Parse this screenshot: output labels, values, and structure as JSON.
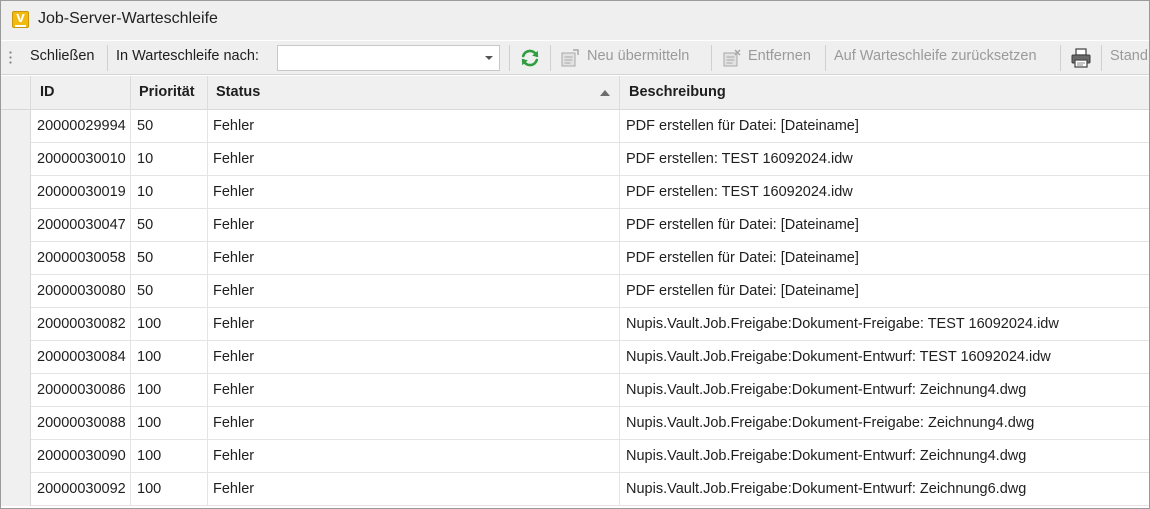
{
  "window": {
    "title": "Job-Server-Warteschleife",
    "app_icon_letter": "V"
  },
  "toolbar": {
    "close_label": "Schließen",
    "hold_label": "In Warteschleife nach:",
    "hold_value": "",
    "refresh_icon": "refresh-icon",
    "resubmit_label": "Neu übermitteln",
    "remove_label": "Entfernen",
    "reset_label": "Auf Warteschleife zurücksetzen",
    "print_icon": "print-icon",
    "standard_label": "Stand"
  },
  "grid": {
    "columns": {
      "id": "ID",
      "priority": "Priorität",
      "status": "Status",
      "description": "Beschreibung"
    },
    "sort_column": "Status",
    "sort_direction": "ascending",
    "rows": [
      {
        "id": "20000029994",
        "priority": "50",
        "status": "Fehler",
        "description": "PDF erstellen für Datei: [Dateiname]"
      },
      {
        "id": "20000030010",
        "priority": "10",
        "status": "Fehler",
        "description": "PDF erstellen: TEST 16092024.idw"
      },
      {
        "id": "20000030019",
        "priority": "10",
        "status": "Fehler",
        "description": "PDF erstellen: TEST 16092024.idw"
      },
      {
        "id": "20000030047",
        "priority": "50",
        "status": "Fehler",
        "description": "PDF erstellen für Datei: [Dateiname]"
      },
      {
        "id": "20000030058",
        "priority": "50",
        "status": "Fehler",
        "description": "PDF erstellen für Datei: [Dateiname]"
      },
      {
        "id": "20000030080",
        "priority": "50",
        "status": "Fehler",
        "description": "PDF erstellen für Datei: [Dateiname]"
      },
      {
        "id": "20000030082",
        "priority": "100",
        "status": "Fehler",
        "description": "Nupis.Vault.Job.Freigabe:Dokument-Freigabe: TEST 16092024.idw"
      },
      {
        "id": "20000030084",
        "priority": "100",
        "status": "Fehler",
        "description": "Nupis.Vault.Job.Freigabe:Dokument-Entwurf: TEST 16092024.idw"
      },
      {
        "id": "20000030086",
        "priority": "100",
        "status": "Fehler",
        "description": "Nupis.Vault.Job.Freigabe:Dokument-Entwurf: Zeichnung4.dwg"
      },
      {
        "id": "20000030088",
        "priority": "100",
        "status": "Fehler",
        "description": "Nupis.Vault.Job.Freigabe:Dokument-Freigabe: Zeichnung4.dwg"
      },
      {
        "id": "20000030090",
        "priority": "100",
        "status": "Fehler",
        "description": "Nupis.Vault.Job.Freigabe:Dokument-Entwurf: Zeichnung4.dwg"
      },
      {
        "id": "20000030092",
        "priority": "100",
        "status": "Fehler",
        "description": "Nupis.Vault.Job.Freigabe:Dokument-Entwurf: Zeichnung6.dwg"
      }
    ]
  },
  "colors": {
    "app_icon": "#f2b90f",
    "refresh_icon": "#2e9e3e",
    "disabled_text": "#9a9a9a",
    "chrome_background": "#efefef"
  }
}
